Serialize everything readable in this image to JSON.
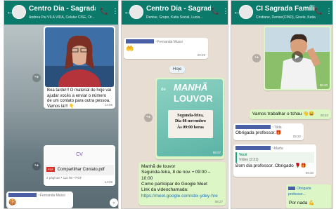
{
  "panel1": {
    "header": {
      "title": "Centro Dia - Sagrada Famí",
      "subtitle": "Andrea Pai VILA VIDA, Celular CISE, Or..."
    },
    "msg1": {
      "text": "Boa tarde!!! O material de hoje vai ajudar vocês a enviar o número de um contato para outra pessoa. Vamos lá!!! 👇",
      "time": "14:05"
    },
    "contact_card": {
      "label": "Compartilhar Contato.pdf",
      "meta": "2 páginas • 110 kB • PDF",
      "time": "14:05"
    },
    "sender": "~Fernanda Mussi"
  },
  "panel2": {
    "header": {
      "title": "Centro Dia - Sagrada F...",
      "subtitle": "Denise, Grupo, Katia Social, Lucia..."
    },
    "sender": "~Fernanda Mussi",
    "sticker_time": "20:29",
    "date_pill": "Hoje",
    "poster": {
      "title_top": "MANHÃ",
      "title_bottom": "LOUVOR",
      "prefix": "de",
      "day": "Segunda-feira,",
      "date": "Dia 08 novembro",
      "hour": "Às 09:00 horas",
      "time": "08:27"
    },
    "msg": {
      "line1": "Manhã de louvor",
      "line2": "Segunda-feira, 8 de nov. • 09:00 – 10:00",
      "line3": "Como participar do Google Meet",
      "line4": "Link da videochamada:",
      "link": "https://meet.google.com/sbx-ydey-hre",
      "time": "08:27"
    }
  },
  "panel3": {
    "header": {
      "title": "CI Sagrada Família",
      "subtitle": "Cristiane, Denise(CIND), Gisele, Katia, Lu..."
    },
    "video_time": "08:40",
    "msg_tchau": {
      "text": "Vamos trabalhar o tchau 👋😄",
      "time": "08:40"
    },
    "reply1": {
      "sender": "~Tilda",
      "text": "Obrigada professor.🎁",
      "time": "09:20"
    },
    "reply2": {
      "sender": "~Marta",
      "quote_name": "Você",
      "quote_text": "Vídeo (2:31)",
      "text": "Bom dia professor. Obrigado 🌹🎁",
      "time": "09:30"
    },
    "out1": {
      "text": "Obrigada professor...",
      "time": "09:33"
    },
    "out2": {
      "text": "Por nada 💪",
      "time": "09:33"
    }
  },
  "colors": {
    "header": "#0b7a6b",
    "chat_bg": "#e7ddd2",
    "outgoing": "#dcf7c5"
  }
}
